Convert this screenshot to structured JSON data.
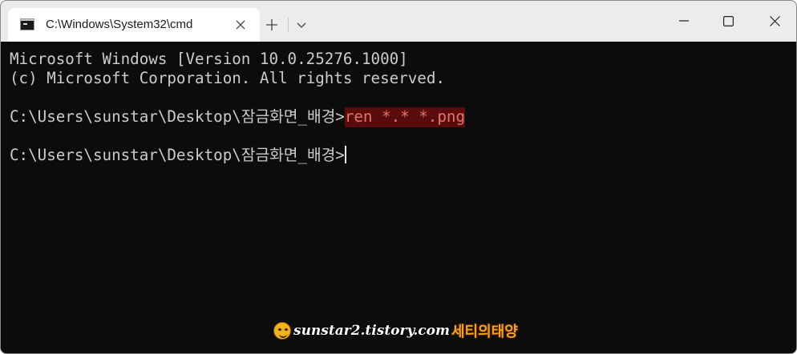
{
  "tab": {
    "title": "C:\\Windows\\System32\\cmd"
  },
  "titlebar": {
    "new_tab_glyph": "+",
    "dropdown_glyph": "⌵"
  },
  "terminal": {
    "lines": [
      "Microsoft Windows [Version 10.0.25276.1000]",
      "(c) Microsoft Corporation. All rights reserved."
    ],
    "prompt": "C:\\Users\\sunstar\\Desktop\\잠금화면_배경>",
    "command": "ren *.* *.png"
  },
  "watermark": {
    "site": "sunstar2.tistory.com",
    "name": "세티의태양"
  },
  "colors": {
    "terminal_bg": "#0c0c0c",
    "terminal_text": "#cccccc",
    "highlight_bg": "#5a0b0b",
    "highlight_text": "#e0776a",
    "titlebar_bg": "#ececec"
  }
}
